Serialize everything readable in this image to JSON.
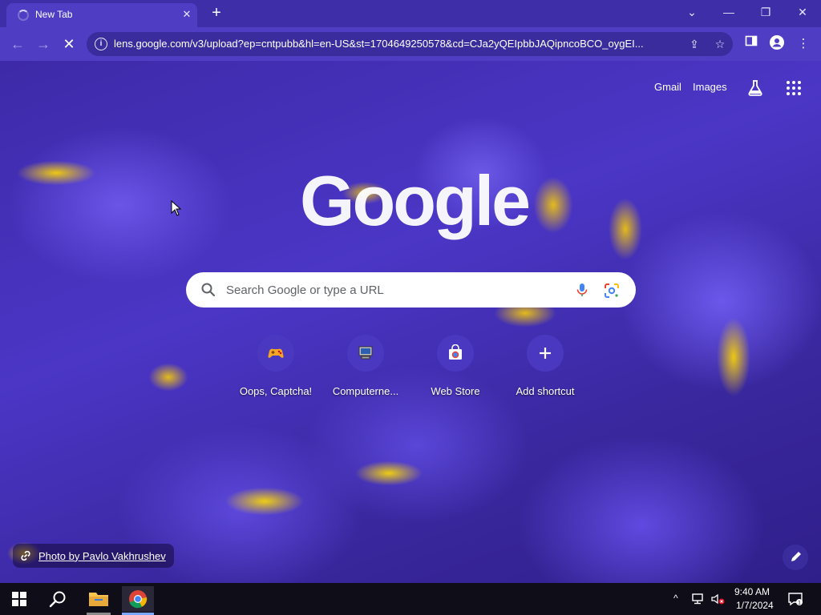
{
  "browser": {
    "tab_title": "New Tab",
    "tab_close_glyph": "✕",
    "new_tab_glyph": "+",
    "window_controls": [
      "⌄",
      "—",
      "❐",
      "✕"
    ],
    "url": "lens.google.com/v3/upload?ep=cntpubb&hl=en-US&st=1704649250578&cd=CJa2yQEIpbbJAQipncoBCO_oygEI...",
    "back_glyph": "←",
    "forward_glyph": "→",
    "stop_glyph": "✕",
    "url_info_glyph": "i",
    "share_glyph": "⇪",
    "star_glyph": "☆",
    "menu_glyph": "⋮"
  },
  "ntp": {
    "top_links": {
      "gmail": "Gmail",
      "images": "Images"
    },
    "logo_text": "Google",
    "search_placeholder": "Search Google or type a URL",
    "shortcuts": [
      {
        "label": "Oops, Captcha!",
        "icon": "gamepad-icon"
      },
      {
        "label": "Computerne...",
        "icon": "computer-icon"
      },
      {
        "label": "Web Store",
        "icon": "web-store-icon"
      },
      {
        "label": "Add shortcut",
        "icon": "plus-icon"
      }
    ],
    "photo_credit": "Photo by Pavlo Vakhrushev"
  },
  "taskbar": {
    "time": "9:40 AM",
    "date": "1/7/2024",
    "tray_chevron": "^"
  },
  "colors": {
    "tab_strip": "#3e2fa8",
    "toolbar": "#4f3ec4",
    "omnibox": "#3a2c9c",
    "taskbar": "#0f0d18"
  }
}
